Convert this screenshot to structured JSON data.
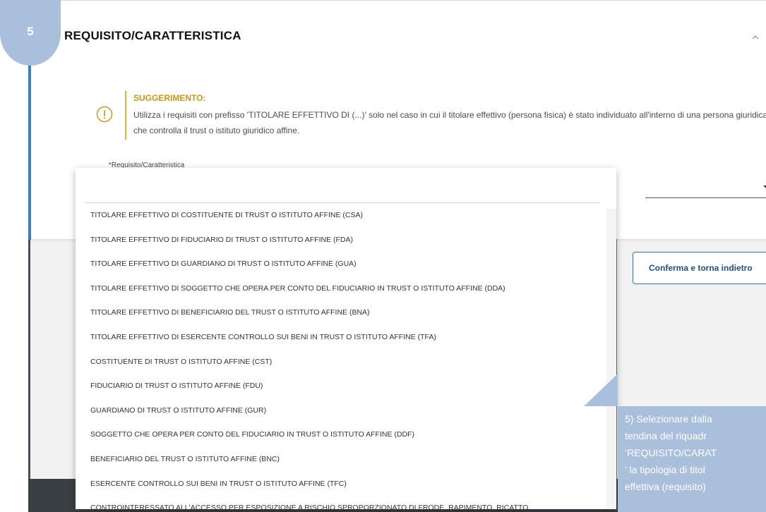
{
  "section": {
    "step_number": "5",
    "title": "REQUISITO/CARATTERISTICA"
  },
  "hint": {
    "title": "SUGGERIMENTO:",
    "text": "Utilizza i requisiti con prefisso 'TITOLARE EFFETTIVO DI (...)' solo nel caso in cui il titolare effettivo (persona fisica) è stato individuato all'interno di una persona giuridica che controlla il trust o istituto giuridico affine."
  },
  "field": {
    "label": "*Requisito/Caratteristica",
    "search_value": ""
  },
  "dropdown": {
    "options": [
      "TITOLARE EFFETTIVO DI COSTITUENTE DI TRUST O ISTITUTO AFFINE (CSA)",
      "TITOLARE EFFETTIVO DI FIDUCIARIO DI TRUST O ISTITUTO AFFINE (FDA)",
      "TITOLARE EFFETTIVO DI GUARDIANO DI TRUST O ISTITUTO AFFINE (GUA)",
      "TITOLARE EFFETTIVO DI SOGGETTO CHE OPERA PER CONTO DEL FIDUCIARIO IN TRUST O ISTITUTO AFFINE (DDA)",
      "TITOLARE EFFETTIVO DI BENEFICIARIO DEL TRUST O ISTITUTO AFFINE (BNA)",
      "TITOLARE EFFETTIVO DI ESERCENTE CONTROLLO SUI BENI IN TRUST O ISTITUTO AFFINE (TFA)",
      "COSTITUENTE DI TRUST O ISTITUTO AFFINE (CST)",
      "FIDUCIARIO DI TRUST O ISTITUTO AFFINE (FDU)",
      "GUARDIANO DI TRUST O ISTITUTO AFFINE (GUR)",
      "SOGGETTO CHE OPERA PER CONTO DEL FIDUCIARIO IN TRUST O ISTITUTO AFFINE (DDF)",
      "BENEFICIARIO DEL TRUST O ISTITUTO AFFINE (BNC)",
      "ESERCENTE CONTROLLO SUI BENI IN TRUST O ISTITUTO AFFINE (TFC)",
      "CONTROINTERESSATO ALL'ACCESSO PER ESPOSIZIONE A RISCHIO SPROPORZIONATO DI FRODE, RAPIMENTO, RICATTO,"
    ]
  },
  "buttons": {
    "confirm_label": "Conferma e torna indietro"
  },
  "tooltip": {
    "lines": [
      "5) Selezionare dalla",
      "tendina del riquadr",
      "‘REQUISITO/CARAT",
      "’ la tipologia di titol",
      "effettiva (requisito)"
    ]
  },
  "colors": {
    "accent_blue": "#3b7fbd",
    "badge_blue": "#a9bfdc",
    "hint_gold": "#c9961a",
    "dark_footer": "#3a3f44"
  },
  "icons": {
    "collapse": "chevron-up-icon",
    "hint": "exclamation-circle-icon",
    "info": "info-icon",
    "select": "caret-down-icon"
  }
}
